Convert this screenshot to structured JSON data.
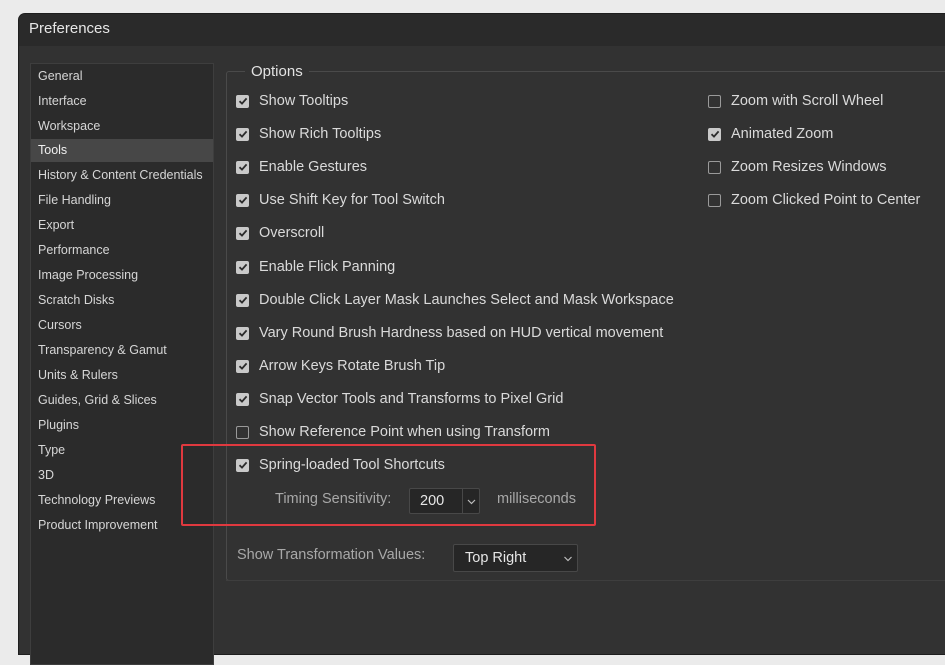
{
  "window": {
    "title": "Preferences"
  },
  "sidebar": {
    "items": [
      {
        "label": "General"
      },
      {
        "label": "Interface"
      },
      {
        "label": "Workspace"
      },
      {
        "label": "Tools",
        "active": true
      },
      {
        "label": "History & Content Credentials"
      },
      {
        "label": "File Handling"
      },
      {
        "label": "Export"
      },
      {
        "label": "Performance"
      },
      {
        "label": "Image Processing"
      },
      {
        "label": "Scratch Disks"
      },
      {
        "label": "Cursors"
      },
      {
        "label": "Transparency & Gamut"
      },
      {
        "label": "Units & Rulers"
      },
      {
        "label": "Guides, Grid & Slices"
      },
      {
        "label": "Plugins"
      },
      {
        "label": "Type"
      },
      {
        "label": "3D"
      },
      {
        "label": "Technology Previews"
      },
      {
        "label": "Product Improvement"
      }
    ]
  },
  "options": {
    "legend": "Options",
    "left": [
      {
        "label": "Show Tooltips",
        "checked": true
      },
      {
        "label": "Show Rich Tooltips",
        "checked": true
      },
      {
        "label": "Enable Gestures",
        "checked": true
      },
      {
        "label": "Use Shift Key for Tool Switch",
        "checked": true
      },
      {
        "label": "Overscroll",
        "checked": true
      },
      {
        "label": "Enable Flick Panning",
        "checked": true
      },
      {
        "label": "Double Click Layer Mask Launches Select and Mask Workspace",
        "checked": true
      },
      {
        "label": "Vary Round Brush Hardness based on HUD vertical movement",
        "checked": true
      },
      {
        "label": "Arrow Keys Rotate Brush Tip",
        "checked": true
      },
      {
        "label": "Snap Vector Tools and Transforms to Pixel Grid",
        "checked": true
      },
      {
        "label": "Show Reference Point when using Transform",
        "checked": false
      },
      {
        "label": "Spring-loaded Tool Shortcuts",
        "checked": true
      }
    ],
    "right": [
      {
        "label": "Zoom with Scroll Wheel",
        "checked": false
      },
      {
        "label": "Animated Zoom",
        "checked": true
      },
      {
        "label": "Zoom Resizes Windows",
        "checked": false
      },
      {
        "label": "Zoom Clicked Point to Center",
        "checked": false
      }
    ],
    "timing": {
      "label": "Timing Sensitivity:",
      "value": "200",
      "unit": "milliseconds"
    }
  },
  "transform_values": {
    "label": "Show Transformation Values:",
    "value": "Top Right"
  },
  "colors": {
    "highlight": "#e0393f",
    "window_bg": "#323232",
    "active_item": "#474747"
  }
}
